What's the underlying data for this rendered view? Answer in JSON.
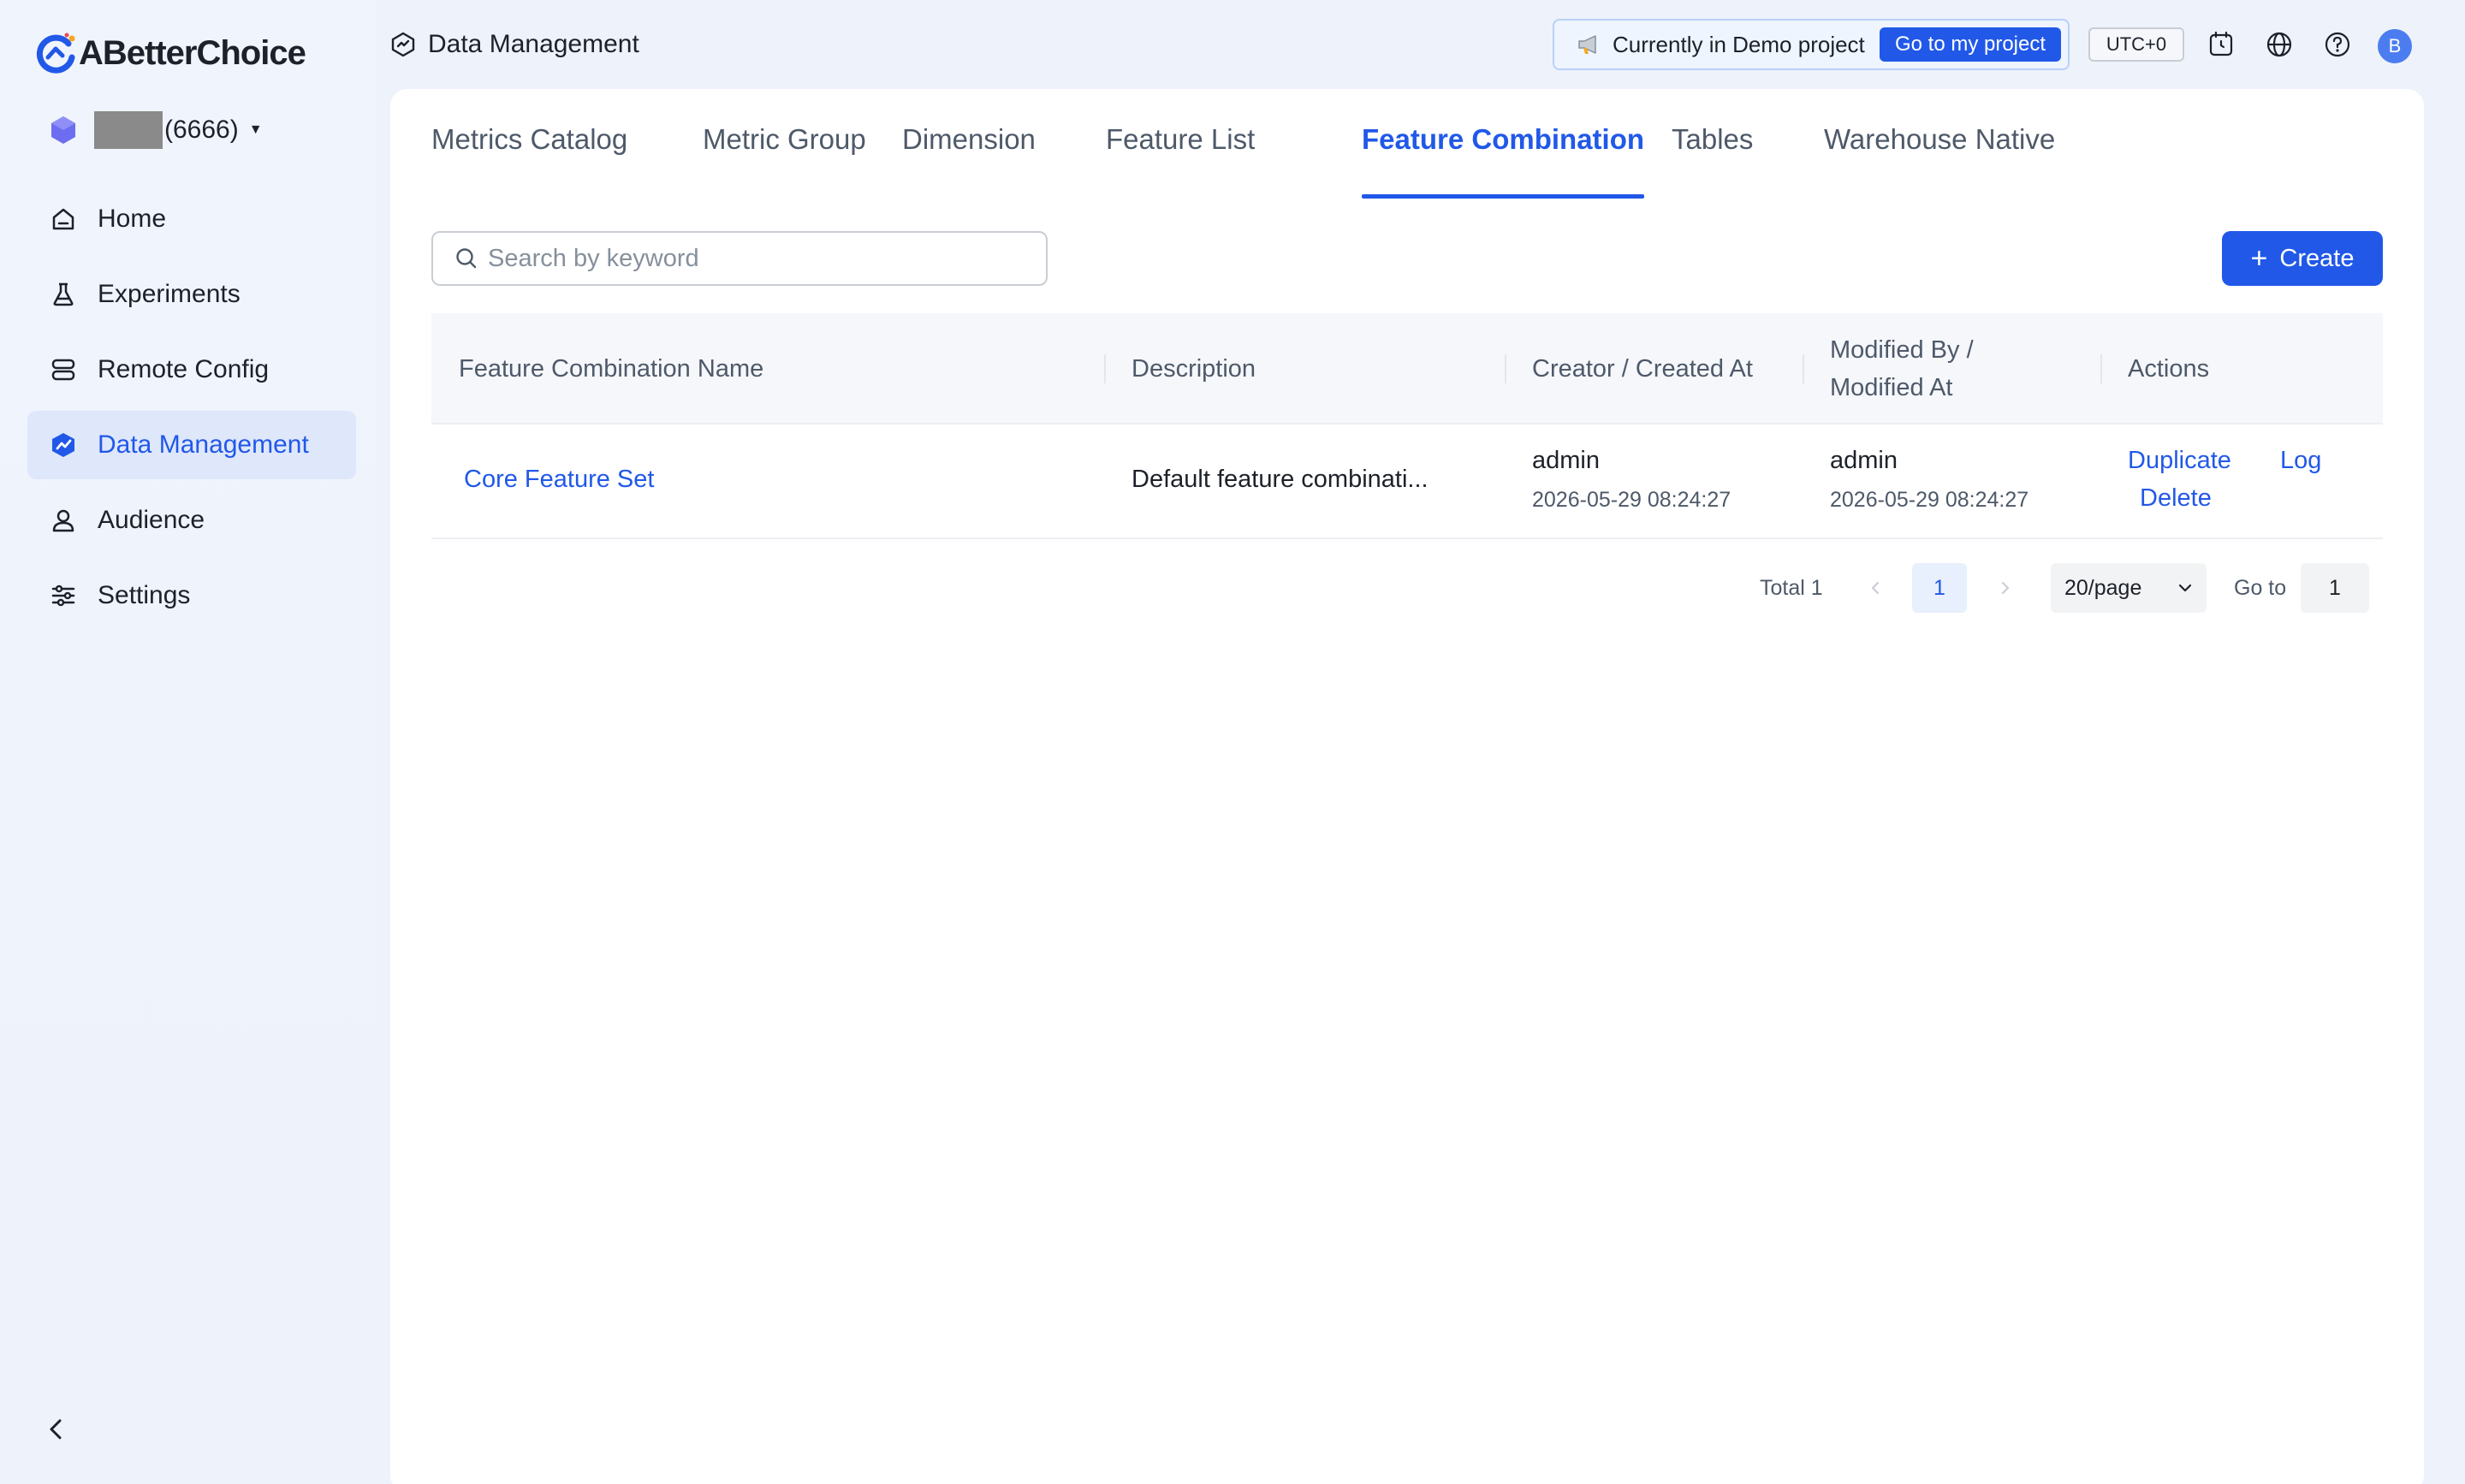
{
  "app": {
    "brand": "ABetterChoice"
  },
  "project": {
    "suffix": "(6666)"
  },
  "sidebar": {
    "items": [
      {
        "label": "Home",
        "icon": "home-icon"
      },
      {
        "label": "Experiments",
        "icon": "flask-icon"
      },
      {
        "label": "Remote Config",
        "icon": "server-icon"
      },
      {
        "label": "Data Management",
        "icon": "chart-icon",
        "active": true
      },
      {
        "label": "Audience",
        "icon": "user-icon"
      },
      {
        "label": "Settings",
        "icon": "sliders-icon"
      }
    ]
  },
  "header": {
    "breadcrumb": "Data Management",
    "demo_text": "Currently in Demo project",
    "demo_button": "Go to my project",
    "timezone": "UTC+0",
    "avatar_initial": "B"
  },
  "tabs": [
    {
      "label": "Metrics Catalog"
    },
    {
      "label": "Metric Group"
    },
    {
      "label": "Dimension"
    },
    {
      "label": "Feature List"
    },
    {
      "label": "Feature Combination",
      "active": true
    },
    {
      "label": "Tables"
    },
    {
      "label": "Warehouse Native"
    }
  ],
  "toolbar": {
    "search_placeholder": "Search by keyword",
    "create_label": "Create"
  },
  "table": {
    "headers": {
      "name": "Feature Combination Name",
      "description": "Description",
      "creator": "Creator / Created At",
      "modified_line1": "Modified By /",
      "modified_line2": "Modified At",
      "actions": "Actions"
    },
    "rows": [
      {
        "name": "Core Feature Set",
        "description": "Default feature combinati...",
        "creator": "admin",
        "created_at": "2026-05-29 08:24:27",
        "modified_by": "admin",
        "modified_at": "2026-05-29 08:24:27",
        "actions": {
          "duplicate": "Duplicate",
          "log": "Log",
          "delete": "Delete"
        }
      }
    ]
  },
  "pagination": {
    "total": "Total 1",
    "current_page": "1",
    "page_size": "20/page",
    "goto_label": "Go to",
    "goto_value": "1"
  },
  "colors": {
    "accent": "#2158e8",
    "active_nav_bg": "#dfe7fb",
    "page_bg": "#eef2fb"
  }
}
